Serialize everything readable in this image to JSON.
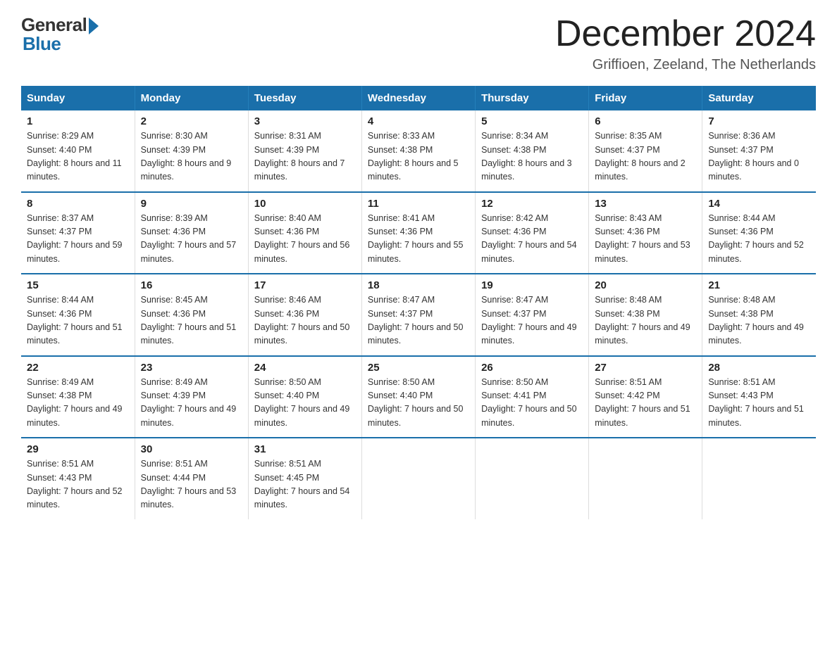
{
  "logo": {
    "general": "General",
    "blue": "Blue"
  },
  "title": "December 2024",
  "location": "Griffioen, Zeeland, The Netherlands",
  "days_header": [
    "Sunday",
    "Monday",
    "Tuesday",
    "Wednesday",
    "Thursday",
    "Friday",
    "Saturday"
  ],
  "weeks": [
    [
      {
        "num": "1",
        "sunrise": "8:29 AM",
        "sunset": "4:40 PM",
        "daylight": "8 hours and 11 minutes."
      },
      {
        "num": "2",
        "sunrise": "8:30 AM",
        "sunset": "4:39 PM",
        "daylight": "8 hours and 9 minutes."
      },
      {
        "num": "3",
        "sunrise": "8:31 AM",
        "sunset": "4:39 PM",
        "daylight": "8 hours and 7 minutes."
      },
      {
        "num": "4",
        "sunrise": "8:33 AM",
        "sunset": "4:38 PM",
        "daylight": "8 hours and 5 minutes."
      },
      {
        "num": "5",
        "sunrise": "8:34 AM",
        "sunset": "4:38 PM",
        "daylight": "8 hours and 3 minutes."
      },
      {
        "num": "6",
        "sunrise": "8:35 AM",
        "sunset": "4:37 PM",
        "daylight": "8 hours and 2 minutes."
      },
      {
        "num": "7",
        "sunrise": "8:36 AM",
        "sunset": "4:37 PM",
        "daylight": "8 hours and 0 minutes."
      }
    ],
    [
      {
        "num": "8",
        "sunrise": "8:37 AM",
        "sunset": "4:37 PM",
        "daylight": "7 hours and 59 minutes."
      },
      {
        "num": "9",
        "sunrise": "8:39 AM",
        "sunset": "4:36 PM",
        "daylight": "7 hours and 57 minutes."
      },
      {
        "num": "10",
        "sunrise": "8:40 AM",
        "sunset": "4:36 PM",
        "daylight": "7 hours and 56 minutes."
      },
      {
        "num": "11",
        "sunrise": "8:41 AM",
        "sunset": "4:36 PM",
        "daylight": "7 hours and 55 minutes."
      },
      {
        "num": "12",
        "sunrise": "8:42 AM",
        "sunset": "4:36 PM",
        "daylight": "7 hours and 54 minutes."
      },
      {
        "num": "13",
        "sunrise": "8:43 AM",
        "sunset": "4:36 PM",
        "daylight": "7 hours and 53 minutes."
      },
      {
        "num": "14",
        "sunrise": "8:44 AM",
        "sunset": "4:36 PM",
        "daylight": "7 hours and 52 minutes."
      }
    ],
    [
      {
        "num": "15",
        "sunrise": "8:44 AM",
        "sunset": "4:36 PM",
        "daylight": "7 hours and 51 minutes."
      },
      {
        "num": "16",
        "sunrise": "8:45 AM",
        "sunset": "4:36 PM",
        "daylight": "7 hours and 51 minutes."
      },
      {
        "num": "17",
        "sunrise": "8:46 AM",
        "sunset": "4:36 PM",
        "daylight": "7 hours and 50 minutes."
      },
      {
        "num": "18",
        "sunrise": "8:47 AM",
        "sunset": "4:37 PM",
        "daylight": "7 hours and 50 minutes."
      },
      {
        "num": "19",
        "sunrise": "8:47 AM",
        "sunset": "4:37 PM",
        "daylight": "7 hours and 49 minutes."
      },
      {
        "num": "20",
        "sunrise": "8:48 AM",
        "sunset": "4:38 PM",
        "daylight": "7 hours and 49 minutes."
      },
      {
        "num": "21",
        "sunrise": "8:48 AM",
        "sunset": "4:38 PM",
        "daylight": "7 hours and 49 minutes."
      }
    ],
    [
      {
        "num": "22",
        "sunrise": "8:49 AM",
        "sunset": "4:38 PM",
        "daylight": "7 hours and 49 minutes."
      },
      {
        "num": "23",
        "sunrise": "8:49 AM",
        "sunset": "4:39 PM",
        "daylight": "7 hours and 49 minutes."
      },
      {
        "num": "24",
        "sunrise": "8:50 AM",
        "sunset": "4:40 PM",
        "daylight": "7 hours and 49 minutes."
      },
      {
        "num": "25",
        "sunrise": "8:50 AM",
        "sunset": "4:40 PM",
        "daylight": "7 hours and 50 minutes."
      },
      {
        "num": "26",
        "sunrise": "8:50 AM",
        "sunset": "4:41 PM",
        "daylight": "7 hours and 50 minutes."
      },
      {
        "num": "27",
        "sunrise": "8:51 AM",
        "sunset": "4:42 PM",
        "daylight": "7 hours and 51 minutes."
      },
      {
        "num": "28",
        "sunrise": "8:51 AM",
        "sunset": "4:43 PM",
        "daylight": "7 hours and 51 minutes."
      }
    ],
    [
      {
        "num": "29",
        "sunrise": "8:51 AM",
        "sunset": "4:43 PM",
        "daylight": "7 hours and 52 minutes."
      },
      {
        "num": "30",
        "sunrise": "8:51 AM",
        "sunset": "4:44 PM",
        "daylight": "7 hours and 53 minutes."
      },
      {
        "num": "31",
        "sunrise": "8:51 AM",
        "sunset": "4:45 PM",
        "daylight": "7 hours and 54 minutes."
      },
      null,
      null,
      null,
      null
    ]
  ]
}
